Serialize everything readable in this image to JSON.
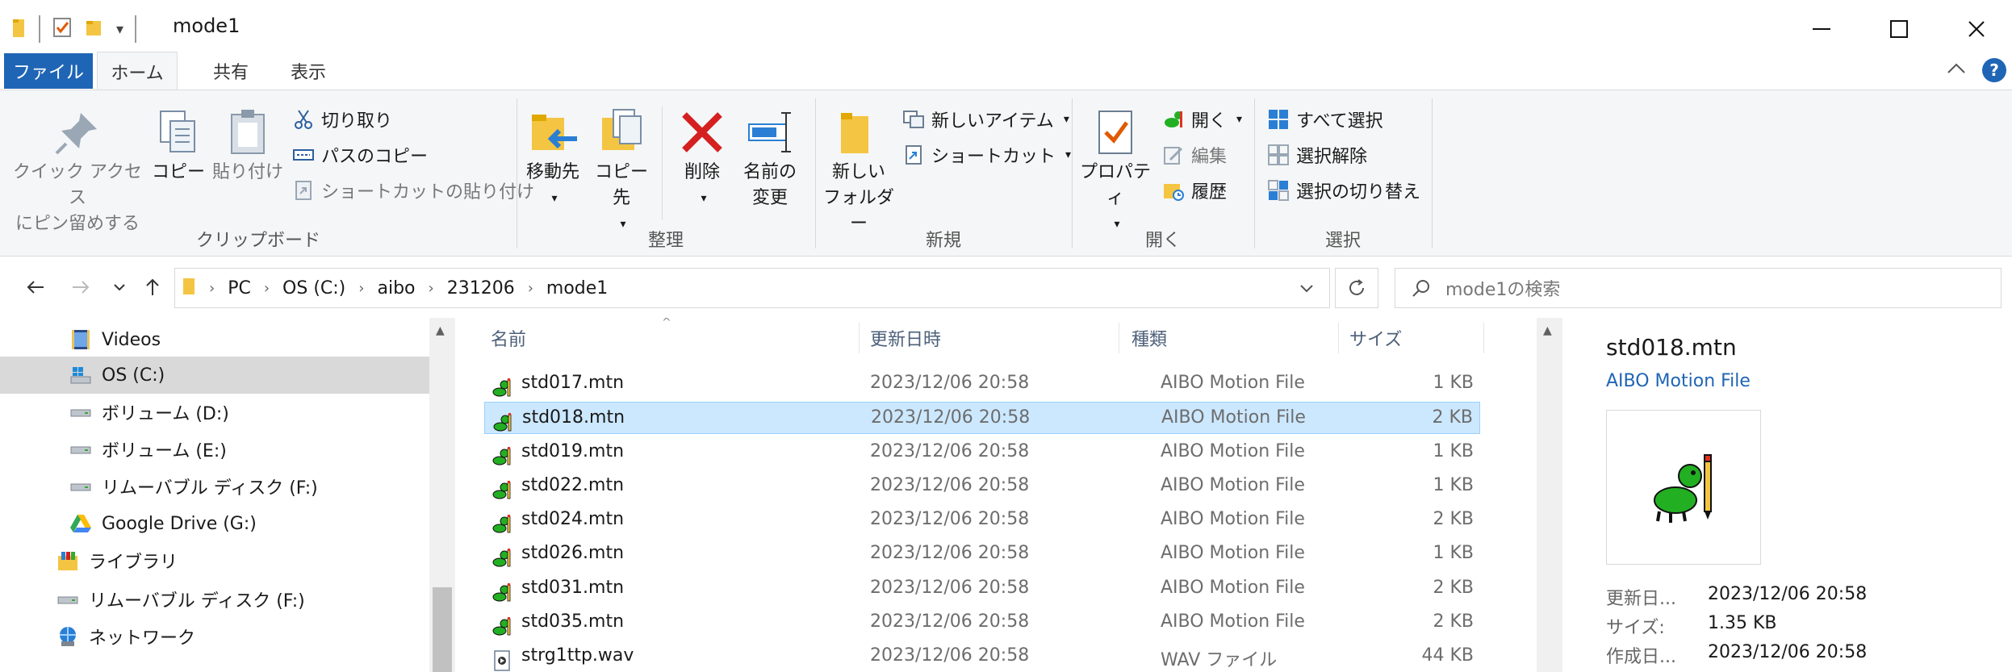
{
  "window": {
    "title": "mode1",
    "qat_dropdown": "▾"
  },
  "ribbon_tabs": [
    {
      "label": "ファイル"
    },
    {
      "label": "ホーム"
    },
    {
      "label": "共有"
    },
    {
      "label": "表示"
    }
  ],
  "ribbon": {
    "clipboard": {
      "pin_line1": "クイック アクセス",
      "pin_line2": "にピン留めする",
      "copy": "コピー",
      "paste": "貼り付け",
      "cut": "切り取り",
      "copy_path": "パスのコピー",
      "paste_shortcut": "ショートカットの貼り付け",
      "label": "クリップボード"
    },
    "organize": {
      "move_to": "移動先",
      "copy_to": "コピー先",
      "delete": "削除",
      "rename_line1": "名前の",
      "rename_line2": "変更",
      "label": "整理"
    },
    "new": {
      "new_item": "新しいアイテム",
      "shortcut": "ショートカット",
      "new_folder_line1": "新しい",
      "new_folder_line2": "フォルダー",
      "label": "新規"
    },
    "open": {
      "properties": "プロパティ",
      "open": "開く",
      "edit": "編集",
      "history": "履歴",
      "label": "開く"
    },
    "select": {
      "select_all": "すべて選択",
      "select_none": "選択解除",
      "invert": "選択の切り替え",
      "label": "選択"
    }
  },
  "address": {
    "crumbs": [
      "PC",
      "OS (C:)",
      "aibo",
      "231206",
      "mode1"
    ],
    "search_placeholder": "mode1の検索"
  },
  "nav_pane": {
    "items": [
      {
        "label": "Videos",
        "icon": "videos-folder-icon",
        "indent": 86
      },
      {
        "label": "OS (C:)",
        "icon": "windows-drive-icon",
        "indent": 86,
        "selected": true
      },
      {
        "label": "ボリューム (D:)",
        "icon": "drive-icon",
        "indent": 86
      },
      {
        "label": "ボリューム (E:)",
        "icon": "drive-icon",
        "indent": 86
      },
      {
        "label": "リムーバブル ディスク (F:)",
        "icon": "drive-icon",
        "indent": 86
      },
      {
        "label": "Google Drive (G:)",
        "icon": "google-drive-icon",
        "indent": 86
      },
      {
        "label": "ライブラリ",
        "icon": "library-icon",
        "indent": 70
      },
      {
        "label": "リムーバブル ディスク (F:)",
        "icon": "drive-icon",
        "indent": 70
      },
      {
        "label": "ネットワーク",
        "icon": "network-icon",
        "indent": 70
      }
    ]
  },
  "file_list": {
    "columns": {
      "name": "名前",
      "date": "更新日時",
      "type": "種類",
      "size": "サイズ"
    },
    "rows": [
      {
        "name": "std017.mtn",
        "date": "2023/12/06 20:58",
        "type": "AIBO Motion File",
        "size": "1 KB",
        "icon": "aibo-motion-file-icon"
      },
      {
        "name": "std018.mtn",
        "date": "2023/12/06 20:58",
        "type": "AIBO Motion File",
        "size": "2 KB",
        "icon": "aibo-motion-file-icon",
        "selected": true
      },
      {
        "name": "std019.mtn",
        "date": "2023/12/06 20:58",
        "type": "AIBO Motion File",
        "size": "1 KB",
        "icon": "aibo-motion-file-icon"
      },
      {
        "name": "std022.mtn",
        "date": "2023/12/06 20:58",
        "type": "AIBO Motion File",
        "size": "1 KB",
        "icon": "aibo-motion-file-icon"
      },
      {
        "name": "std024.mtn",
        "date": "2023/12/06 20:58",
        "type": "AIBO Motion File",
        "size": "2 KB",
        "icon": "aibo-motion-file-icon"
      },
      {
        "name": "std026.mtn",
        "date": "2023/12/06 20:58",
        "type": "AIBO Motion File",
        "size": "1 KB",
        "icon": "aibo-motion-file-icon"
      },
      {
        "name": "std031.mtn",
        "date": "2023/12/06 20:58",
        "type": "AIBO Motion File",
        "size": "2 KB",
        "icon": "aibo-motion-file-icon"
      },
      {
        "name": "std035.mtn",
        "date": "2023/12/06 20:58",
        "type": "AIBO Motion File",
        "size": "2 KB",
        "icon": "aibo-motion-file-icon"
      },
      {
        "name": "strg1ttp.wav",
        "date": "2023/12/06 20:58",
        "type": "WAV ファイル",
        "size": "44 KB",
        "icon": "wav-file-icon"
      }
    ]
  },
  "preview": {
    "name": "std018.mtn",
    "type": "AIBO Motion File",
    "props": [
      {
        "key": "更新日...",
        "value": "2023/12/06 20:58"
      },
      {
        "key": "サイズ:",
        "value": "1.35 KB"
      },
      {
        "key": "作成日...",
        "value": "2023/12/06 20:58"
      }
    ]
  },
  "colors": {
    "accent": "#1f65b5",
    "selection": "#cce8ff",
    "aibo_green": "#22b022"
  }
}
